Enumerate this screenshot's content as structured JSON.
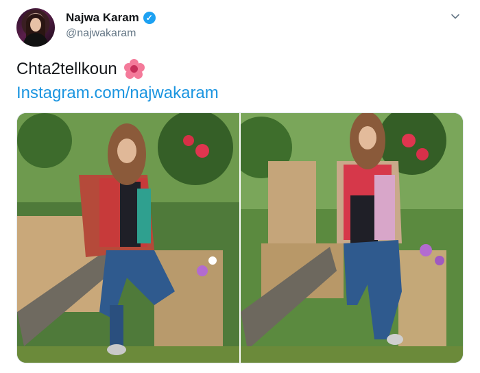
{
  "tweet": {
    "author_name": "Najwa Karam",
    "author_handle": "@najwakaram",
    "text": "Chta2tellkoun",
    "emoji": "hibiscus",
    "link": "Instagram.com/najwakaram"
  },
  "icons": {
    "verified": "verified-badge-icon",
    "menu": "chevron-down-icon",
    "flower": "hibiscus-icon"
  },
  "colors": {
    "name": "#14171a",
    "handle": "#657786",
    "link": "#1b95e0",
    "verified": "#1da1f2"
  }
}
